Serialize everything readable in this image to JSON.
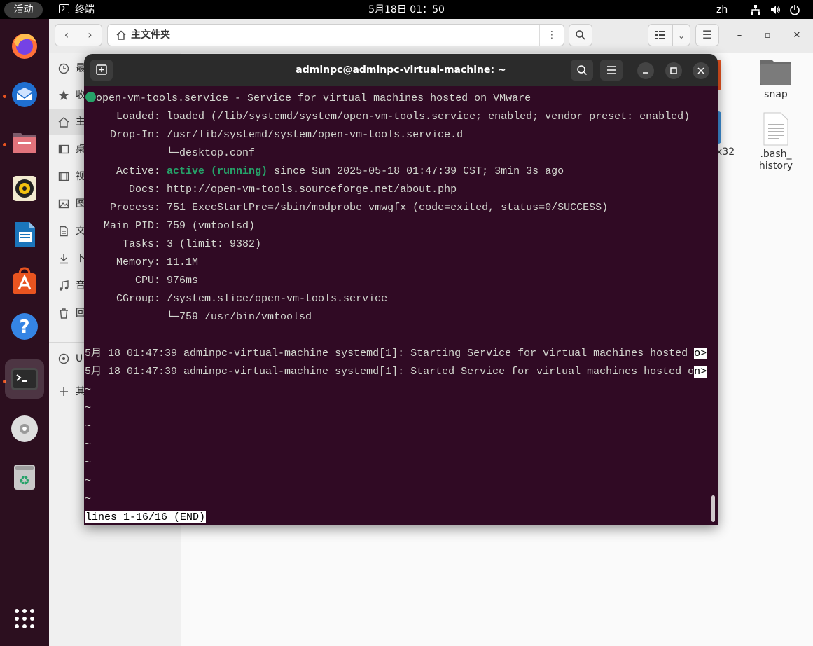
{
  "topbar": {
    "activities": "活动",
    "app_name": "终端",
    "clock": "5月18日  01：50",
    "lang": "zh"
  },
  "dock": {
    "items": [
      "firefox",
      "thunderbird",
      "files",
      "rhythmbox",
      "libreoffice-writer",
      "app-center",
      "help",
      "terminal",
      "dvd",
      "trash"
    ],
    "running": [
      "thunderbird",
      "files",
      "terminal"
    ],
    "active": "terminal"
  },
  "files": {
    "path_label": "主文件夹",
    "sidebar": [
      {
        "icon": "clock-icon",
        "label": "最近使用"
      },
      {
        "icon": "star-icon",
        "label": "收藏"
      },
      {
        "icon": "home-icon",
        "label": "主文件夹",
        "selected": true
      },
      {
        "icon": "desktop-icon",
        "label": "桌面"
      },
      {
        "icon": "video-icon",
        "label": "视频"
      },
      {
        "icon": "picture-icon",
        "label": "图片"
      },
      {
        "icon": "document-icon",
        "label": "文档"
      },
      {
        "icon": "download-icon",
        "label": "下载"
      },
      {
        "icon": "music-icon",
        "label": "音乐"
      },
      {
        "icon": "trash-icon",
        "label": "回收站"
      }
    ],
    "sidebar_extra": [
      {
        "icon": "disc-icon",
        "label": "U"
      },
      {
        "icon": "plus-icon",
        "label": "其"
      }
    ],
    "desktop": {
      "snap": "snap",
      "bash_history_1": ".bash_",
      "bash_history_2": "history",
      "partial_label": "x32"
    }
  },
  "terminal": {
    "title": "adminpc@adminpc-virtual-machine: ~",
    "lines": [
      "open-vm-tools.service - Service for virtual machines hosted on VMware",
      "     Loaded: loaded (/lib/systemd/system/open-vm-tools.service; enabled; vendor preset: enabled)",
      "    Drop-In: /usr/lib/systemd/system/open-vm-tools.service.d",
      "             └─desktop.conf",
      "     Active: ",
      "active (running)",
      " since Sun 2025-05-18 01:47:39 CST; 3min 3s ago",
      "       Docs: http://open-vm-tools.sourceforge.net/about.php",
      "    Process: 751 ExecStartPre=/sbin/modprobe vmwgfx (code=exited, status=0/SUCCESS)",
      "   Main PID: 759 (vmtoolsd)",
      "      Tasks: 3 (limit: 9382)",
      "     Memory: 11.1M",
      "        CPU: 976ms",
      "     CGroup: /system.slice/open-vm-tools.service",
      "             └─759 /usr/bin/vmtoolsd",
      "",
      "5月 18 01:47:39 adminpc-virtual-machine systemd[1]: Starting Service for virtual machines hosted ",
      "o>",
      "5月 18 01:47:39 adminpc-virtual-machine systemd[1]: Started Service for virtual machines hosted o",
      "n>",
      "~",
      "lines 1-16/16 (END)"
    ]
  }
}
